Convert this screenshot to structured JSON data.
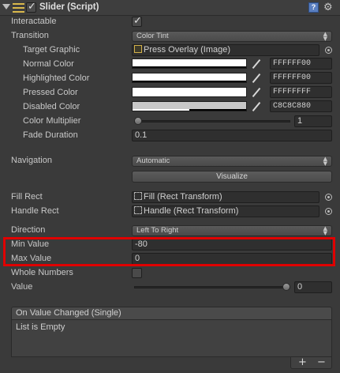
{
  "component": {
    "title": "Slider (Script)",
    "enabled": true,
    "icons": {
      "fold": "fold-arrow-icon",
      "script": "script-icon",
      "help": "help-icon",
      "settings": "gear-icon"
    },
    "help_glyph": "?",
    "gear_glyph": "⚙"
  },
  "interactable": {
    "label": "Interactable",
    "checked": true
  },
  "transition": {
    "label": "Transition",
    "value": "Color Tint",
    "target_graphic": {
      "label": "Target Graphic",
      "value": "Press Overlay (Image)"
    },
    "normal_color": {
      "label": "Normal Color",
      "hex": "FFFFFF00"
    },
    "highlighted_color": {
      "label": "Highlighted Color",
      "hex": "FFFFFF00"
    },
    "pressed_color": {
      "label": "Pressed Color",
      "hex": "FFFFFFFF"
    },
    "disabled_color": {
      "label": "Disabled Color",
      "hex": "C8C8C880",
      "swatch": "#C8C8C8",
      "alpha_fraction": 0.5
    },
    "color_multiplier": {
      "label": "Color Multiplier",
      "value": "1",
      "slider_fraction": 0.0
    },
    "fade_duration": {
      "label": "Fade Duration",
      "value": "0.1"
    }
  },
  "navigation": {
    "label": "Navigation",
    "value": "Automatic",
    "visualize_label": "Visualize"
  },
  "fill_rect": {
    "label": "Fill Rect",
    "value": "Fill (Rect Transform)"
  },
  "handle_rect": {
    "label": "Handle Rect",
    "value": "Handle (Rect Transform)"
  },
  "direction": {
    "label": "Direction",
    "value": "Left To Right"
  },
  "min_value": {
    "label": "Min Value",
    "value": "-80"
  },
  "max_value": {
    "label": "Max Value",
    "value": "0"
  },
  "whole_numbers": {
    "label": "Whole Numbers",
    "checked": false
  },
  "value": {
    "label": "Value",
    "value": "0",
    "slider_fraction": 1.0
  },
  "event": {
    "title": "On Value Changed (Single)",
    "body": "List is Empty",
    "add_glyph": "+",
    "remove_glyph": "−"
  },
  "colors": {
    "highlight_border": "#E00000",
    "panel_bg": "#3A3A3A"
  }
}
